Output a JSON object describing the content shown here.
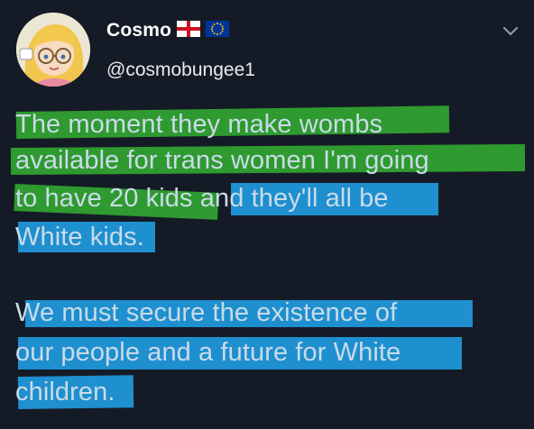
{
  "user": {
    "display_name": "Cosmo",
    "handle": "@cosmobungee1",
    "flags": [
      "england-flag-icon",
      "eu-flag-icon"
    ]
  },
  "tweet": {
    "lines": [
      "The moment they make wombs",
      "available for trans women I'm going",
      "to have 20 kids",
      "and they'll all be",
      "White kids.",
      "We must secure the existence of",
      "our people and a future for White",
      "children."
    ]
  },
  "colors": {
    "background": "#151b26",
    "highlight_green": "#2f9a2f",
    "highlight_blue": "#1e8fcf"
  }
}
